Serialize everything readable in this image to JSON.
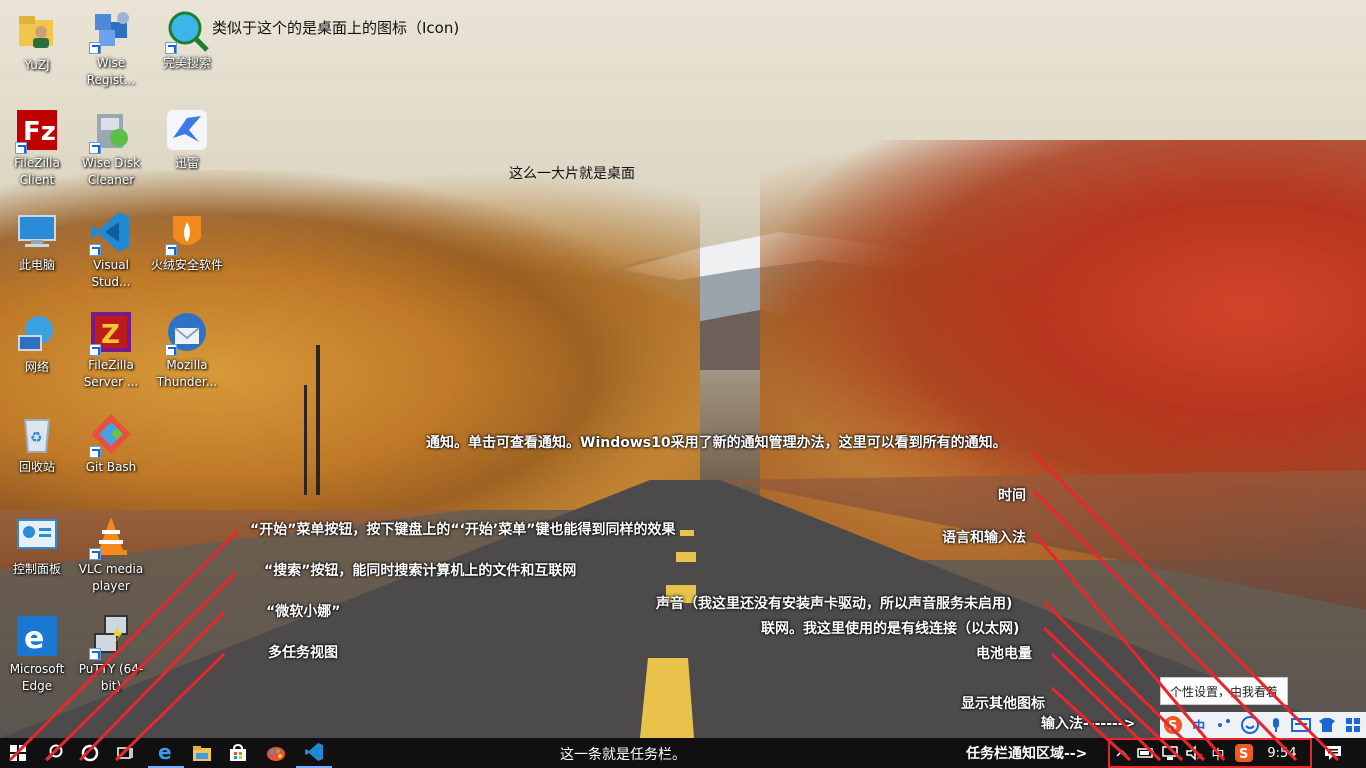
{
  "desktop_icons": [
    {
      "label": "YuZJ",
      "icon": "user-folder-icon"
    },
    {
      "label": "Wise Regist...",
      "icon": "wise-registry-icon"
    },
    {
      "label": "完美搜索",
      "icon": "search-globe-icon"
    },
    {
      "label": "FileZilla Client",
      "icon": "filezilla-icon"
    },
    {
      "label": "Wise Disk Cleaner",
      "icon": "wise-disk-cleaner-icon"
    },
    {
      "label": "迅雷",
      "icon": "thunder-bird-icon"
    },
    {
      "label": "此电脑",
      "icon": "this-pc-icon"
    },
    {
      "label": "Visual Stud...",
      "icon": "vscode-icon"
    },
    {
      "label": "火绒安全软件",
      "icon": "huorong-icon"
    },
    {
      "label": "网络",
      "icon": "network-icon"
    },
    {
      "label": "FileZilla Server ...",
      "icon": "filezilla-server-icon"
    },
    {
      "label": "Mozilla Thunder...",
      "icon": "thunderbird-icon"
    },
    {
      "label": "回收站",
      "icon": "recycle-bin-icon"
    },
    {
      "label": "Git Bash",
      "icon": "git-icon"
    },
    {
      "label": "控制面板",
      "icon": "control-panel-icon"
    },
    {
      "label": "VLC media player",
      "icon": "vlc-icon"
    },
    {
      "label": "Microsoft Edge",
      "icon": "edge-icon"
    },
    {
      "label": "PuTTY (64-bit)",
      "icon": "putty-icon"
    }
  ],
  "annotations": {
    "icon_note": "类似于这个的是桌面上的图标（Icon)",
    "desktop_note": "这么一大片就是桌面",
    "notification_note": "通知。单击可查看通知。Windows10采用了新的通知管理办法，这里可以看到所有的通知。",
    "time_note": "时间",
    "language_note": "语言和输入法",
    "start_note": "“开始”菜单按钮，按下键盘上的“‘开始’菜单”键也能得到同样的效果",
    "search_note": "“搜索”按钮，能同时搜索计算机上的文件和互联网",
    "cortana_note": "“微软小娜”",
    "taskview_note": "多任务视图",
    "sound_note": "声音（我这里还没有安装声卡驱动，所以声音服务未启用)",
    "network_note": "联网。我这里使用的是有线连接（以太网)",
    "battery_note": "电池电量",
    "hidden_icons_note": "显示其他图标",
    "ime_note": "输入法------->",
    "taskbar_note": "这一条就是任务栏。",
    "tray_area_note": "任务栏通知区域-->"
  },
  "ime_tooltip": "个性设置，由我看着",
  "ime_bar": {
    "mode_label": "中",
    "icons": [
      "sogou-icon",
      "chinese-mode-icon",
      "punctuation-icon",
      "emoji-icon",
      "mic-icon",
      "keyboard-icon",
      "skin-icon",
      "tools-icon"
    ]
  },
  "taskbar": {
    "pinned": [
      "start-icon",
      "search-icon",
      "cortana-icon",
      "task-view-icon",
      "edge-icon",
      "explorer-icon",
      "store-icon",
      "paint-icon",
      "vscode-icon"
    ],
    "tray": {
      "lang": "中",
      "time": "9:54"
    }
  },
  "colors": {
    "annotation_line": "#e8262d",
    "taskbar_bg": "#101010",
    "annotation_text": "#ffffff"
  }
}
